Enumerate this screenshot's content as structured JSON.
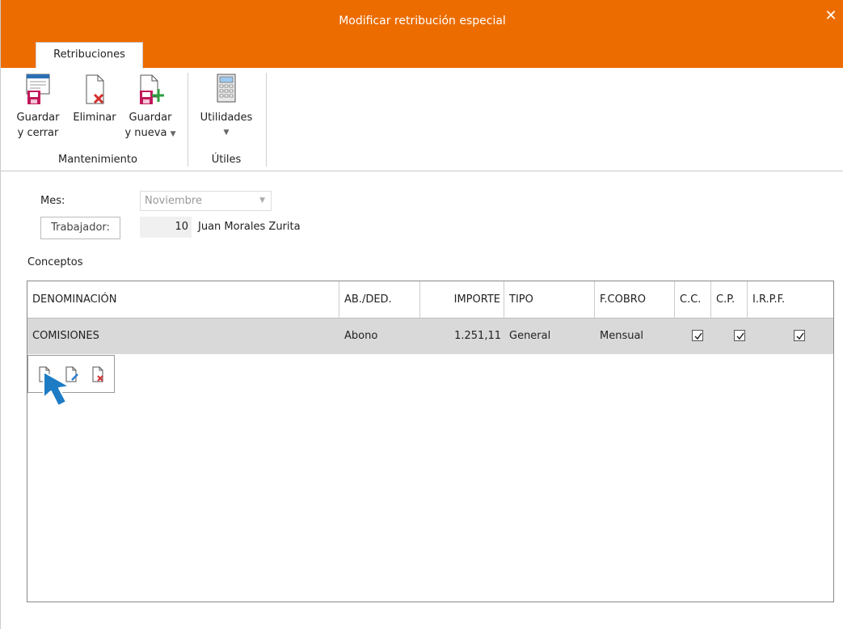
{
  "window": {
    "title": "Modificar retribución especial",
    "close_symbol": "✕",
    "accent_color": "#ec6c00"
  },
  "tabs": [
    {
      "label": "Retribuciones"
    }
  ],
  "ribbon": {
    "buttons": {
      "guardar_cerrar": {
        "line1": "Guardar",
        "line2": "y cerrar",
        "icon": "save-close-icon"
      },
      "eliminar": {
        "line1": "Eliminar",
        "icon": "delete-document-icon"
      },
      "guardar_nueva": {
        "line1": "Guardar",
        "line2": "y nueva",
        "icon": "save-new-icon"
      },
      "utilidades": {
        "line1": "Utilidades",
        "icon": "calculator-icon"
      }
    },
    "groups": {
      "mantenimiento": "Mantenimiento",
      "utiles": "Útiles"
    }
  },
  "form": {
    "mes_label": "Mes:",
    "mes_value": "Noviembre",
    "trabajador_button": "Trabajador:",
    "trabajador_code": "10",
    "trabajador_name": "Juan  Morales Zurita",
    "conceptos_label": "Conceptos"
  },
  "table": {
    "columns": {
      "denominacion": "DENOMINACIÓN",
      "ab_ded": "AB./DED.",
      "importe": "IMPORTE",
      "tipo": "TIPO",
      "f_cobro": "F.COBRO",
      "cc": "C.C.",
      "cp": "C.P.",
      "irpf": "I.R.P.F."
    },
    "rows": [
      {
        "denominacion": "COMISIONES",
        "ab_ded": "Abono",
        "importe": "1.251,11",
        "tipo": "General",
        "f_cobro": "Mensual",
        "cc": true,
        "cp": true,
        "irpf": true
      }
    ]
  },
  "row_toolbar": {
    "icons": [
      "new-row-icon",
      "edit-row-icon",
      "delete-row-icon"
    ]
  }
}
